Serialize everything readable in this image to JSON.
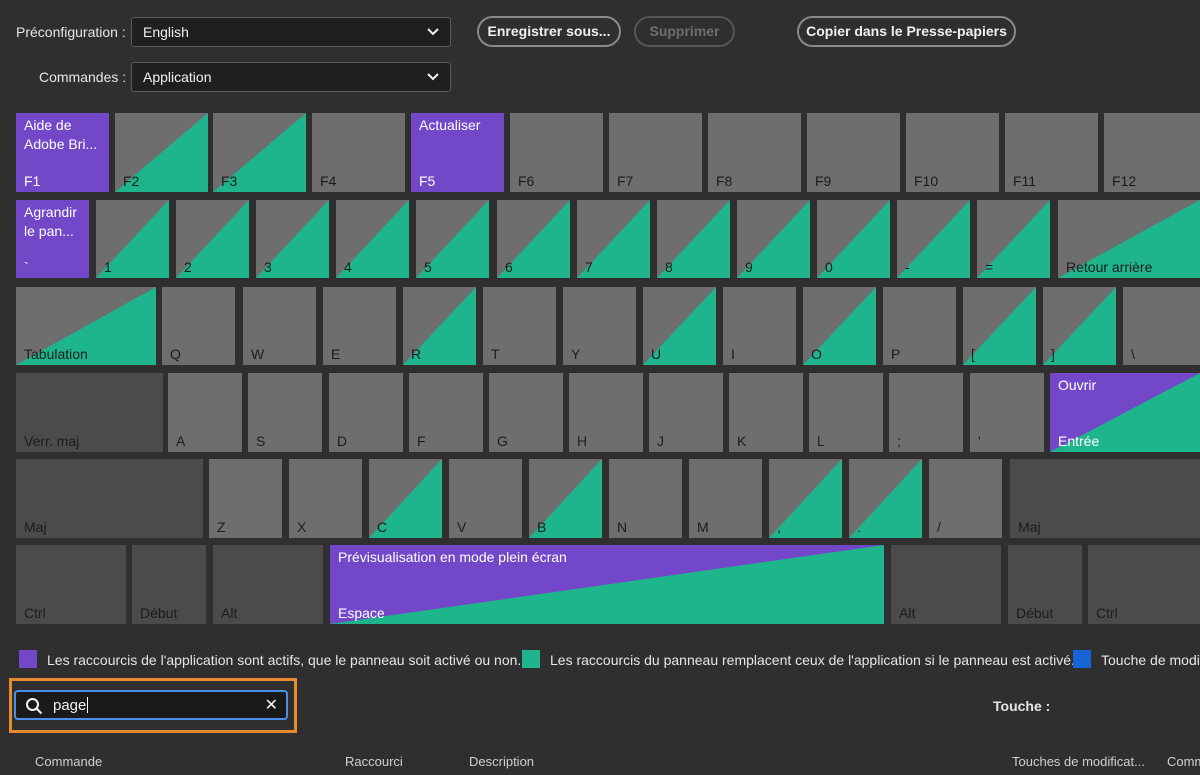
{
  "toolbar": {
    "preset_label": "Préconfiguration :",
    "preset_value": "English",
    "commands_label": "Commandes :",
    "commands_value": "Application",
    "save_as": "Enregistrer sous...",
    "delete": "Supprimer",
    "copy_clipboard": "Copier dans le Presse-papiers"
  },
  "colors": {
    "app_shortcut": "#7248c9",
    "panel_shortcut": "#1fb58c",
    "modifier": "#1664d6",
    "key_default": "#6e6e6e",
    "key_modifier": "#4b4b4b",
    "search_highlight": "#e88a2e"
  },
  "keyboard": {
    "F1": {
      "label": "F1",
      "command": "Aide de\nAdobe Bri..."
    },
    "F2": {
      "label": "F2"
    },
    "F3": {
      "label": "F3"
    },
    "F4": {
      "label": "F4"
    },
    "F5": {
      "label": "F5",
      "command": "Actualiser"
    },
    "F6": {
      "label": "F6"
    },
    "F7": {
      "label": "F7"
    },
    "F8": {
      "label": "F8"
    },
    "F9": {
      "label": "F9"
    },
    "F10": {
      "label": "F10"
    },
    "F11": {
      "label": "F11"
    },
    "F12": {
      "label": "F12"
    },
    "grave": {
      "label": "`",
      "command": "Agrandir\nle pan..."
    },
    "k1": {
      "label": "1"
    },
    "k2": {
      "label": "2"
    },
    "k3": {
      "label": "3"
    },
    "k4": {
      "label": "4"
    },
    "k5": {
      "label": "5"
    },
    "k6": {
      "label": "6"
    },
    "k7": {
      "label": "7"
    },
    "k8": {
      "label": "8"
    },
    "k9": {
      "label": "9"
    },
    "k0": {
      "label": "0"
    },
    "minus": {
      "label": "-"
    },
    "equal": {
      "label": "="
    },
    "backspace": {
      "label": "Retour arrière"
    },
    "tab": {
      "label": "Tabulation"
    },
    "Q": {
      "label": "Q"
    },
    "W": {
      "label": "W"
    },
    "E": {
      "label": "E"
    },
    "R": {
      "label": "R"
    },
    "T": {
      "label": "T"
    },
    "Y": {
      "label": "Y"
    },
    "U": {
      "label": "U"
    },
    "I": {
      "label": "I"
    },
    "O": {
      "label": "O"
    },
    "P": {
      "label": "P"
    },
    "lbracket": {
      "label": "["
    },
    "rbracket": {
      "label": "]"
    },
    "backslash": {
      "label": "\\"
    },
    "capslock": {
      "label": "Verr. maj"
    },
    "A": {
      "label": "A"
    },
    "S": {
      "label": "S"
    },
    "D": {
      "label": "D"
    },
    "F": {
      "label": "F"
    },
    "G": {
      "label": "G"
    },
    "H": {
      "label": "H"
    },
    "J": {
      "label": "J"
    },
    "K": {
      "label": "K"
    },
    "L": {
      "label": "L"
    },
    "semicolon": {
      "label": ";"
    },
    "quote": {
      "label": "'"
    },
    "enter": {
      "label": "Entrée",
      "command": "Ouvrir"
    },
    "lshift": {
      "label": "Maj"
    },
    "Z": {
      "label": "Z"
    },
    "X": {
      "label": "X"
    },
    "C": {
      "label": "C"
    },
    "V": {
      "label": "V"
    },
    "B": {
      "label": "B"
    },
    "N": {
      "label": "N"
    },
    "M": {
      "label": "M"
    },
    "comma": {
      "label": ","
    },
    "period": {
      "label": "."
    },
    "slash": {
      "label": "/"
    },
    "rshift": {
      "label": "Maj"
    },
    "lctrl": {
      "label": "Ctrl"
    },
    "lhome": {
      "label": "Début"
    },
    "lalt": {
      "label": "Alt"
    },
    "space": {
      "label": "Espace",
      "command": "Prévisualisation en mode plein écran"
    },
    "ralt": {
      "label": "Alt"
    },
    "rhome": {
      "label": "Début"
    },
    "rctrl": {
      "label": "Ctrl"
    }
  },
  "legend": {
    "app": "Les raccourcis de l'application sont actifs, que le panneau soit activé ou non.",
    "panel": "Les raccourcis du panneau remplacent ceux de l'application si le panneau est activé.",
    "modifier": "Touche de modi"
  },
  "search": {
    "value": "page"
  },
  "key_label": "Touche :",
  "table": {
    "columns": [
      "Commande",
      "Raccourci",
      "Description",
      "Touches de modificat...",
      "Comm"
    ]
  }
}
